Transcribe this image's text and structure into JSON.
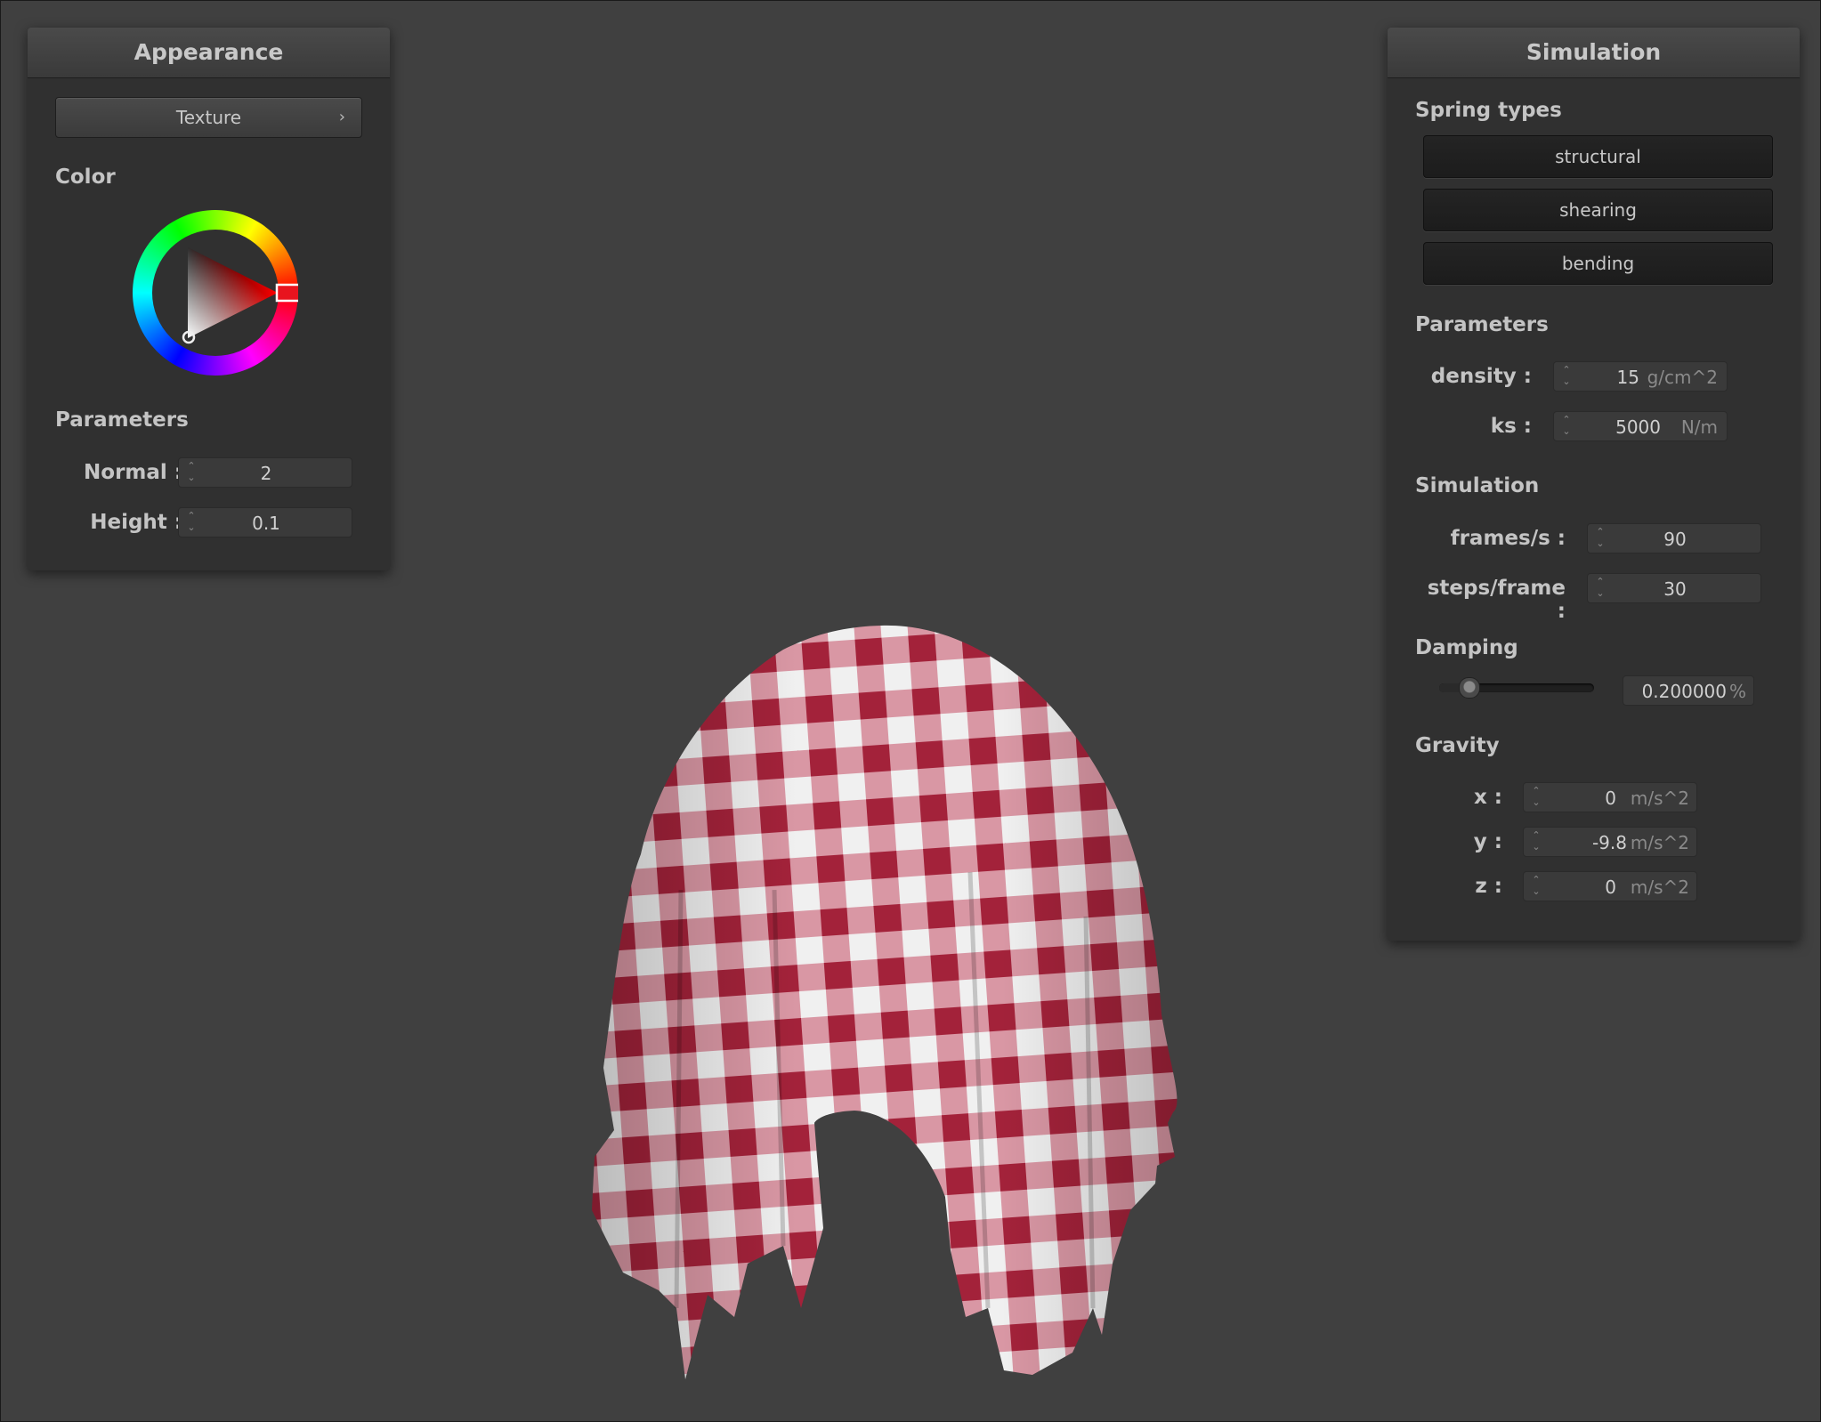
{
  "appearance": {
    "title": "Appearance",
    "texture_button": "Texture",
    "texture_chevron": "›",
    "color_label": "Color",
    "parameters_label": "Parameters",
    "normal_label": "Normal :",
    "normal_value": "2",
    "height_label": "Height :",
    "height_value": "0.1"
  },
  "simulation": {
    "title": "Simulation",
    "spring_types_label": "Spring types",
    "springs": [
      "structural",
      "shearing",
      "bending"
    ],
    "parameters_label": "Parameters",
    "density_label": "density :",
    "density_value": "15",
    "density_unit": "g/cm^2",
    "ks_label": "ks :",
    "ks_value": "5000",
    "ks_unit": "N/m",
    "simulation_label": "Simulation",
    "fps_label": "frames/s :",
    "fps_value": "90",
    "steps_label": "steps/frame :",
    "steps_value": "30",
    "damping_label": "Damping",
    "damping_slider_fraction": 0.2,
    "damping_value": "0.200000",
    "damping_unit": "%",
    "gravity_label": "Gravity",
    "gx_label": "x :",
    "gx_value": "0",
    "gx_unit": "m/s^2",
    "gy_label": "y :",
    "gy_value": "-9.8",
    "gy_unit": "m/s^2",
    "gz_label": "z :",
    "gz_value": "0",
    "gz_unit": "m/s^2"
  },
  "colors": {
    "background": "#404040",
    "panel": "#303030",
    "cloth_red": "#a3223a",
    "cloth_pink": "#dc9aa6",
    "cloth_white": "#f0f0f0",
    "selected_color": "#ff0000"
  },
  "icons": {
    "spinner": "spinner-arrows-icon",
    "chevron": "chevron-right-icon"
  }
}
